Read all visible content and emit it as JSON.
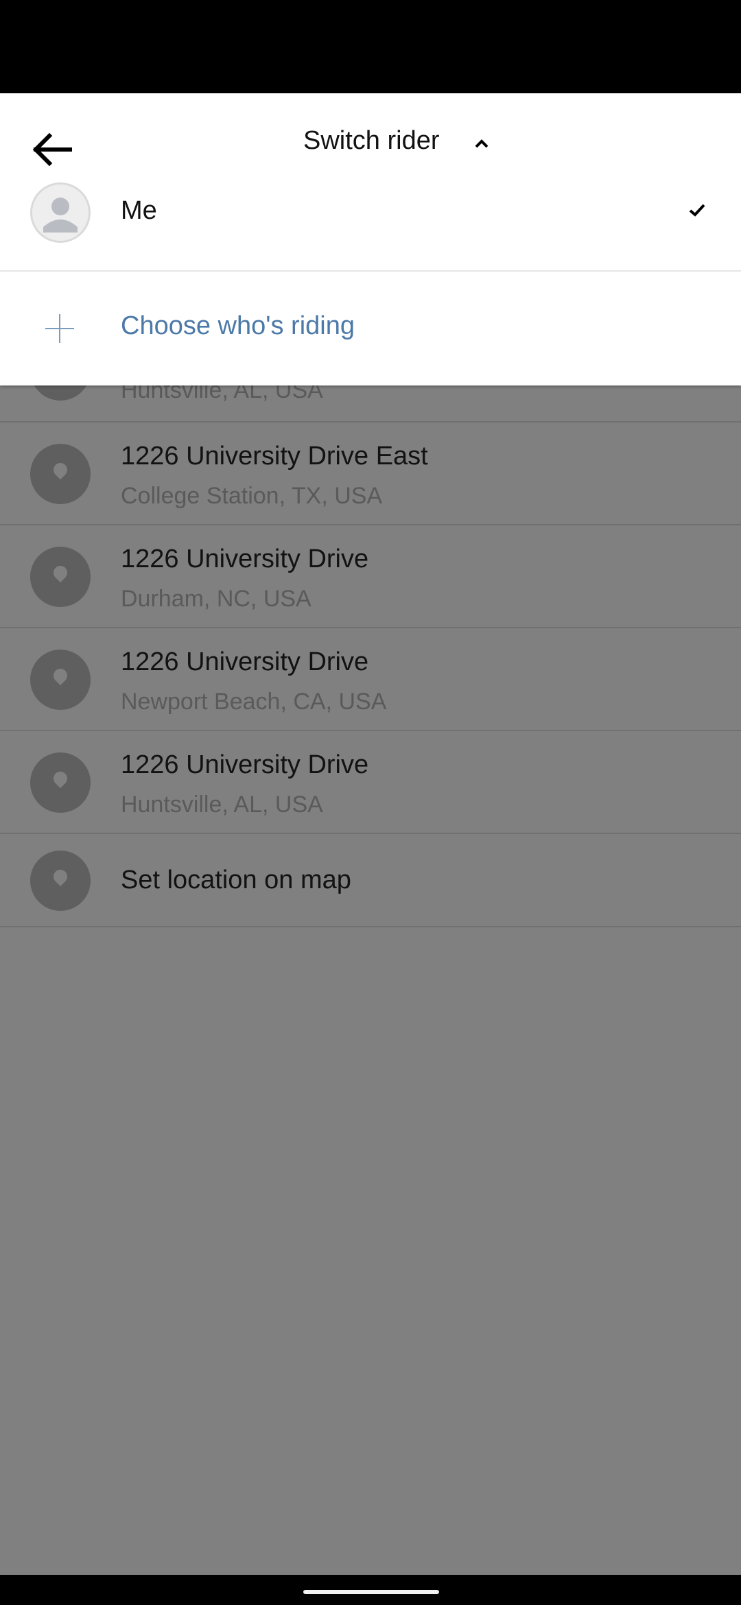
{
  "header": {
    "title": "Switch rider"
  },
  "rider": {
    "name": "Me"
  },
  "choose": {
    "label": "Choose who's riding"
  },
  "results": [
    {
      "title": "",
      "subtitle": "Huntsville, AL, USA"
    },
    {
      "title": "1226 University Drive East",
      "subtitle": "College Station, TX, USA"
    },
    {
      "title": "1226 University Drive",
      "subtitle": "Durham, NC, USA"
    },
    {
      "title": "1226 University Drive",
      "subtitle": "Newport Beach, CA, USA"
    },
    {
      "title": "1226 University Drive",
      "subtitle": "Huntsville, AL, USA"
    }
  ],
  "set_on_map": {
    "label": "Set location on map"
  },
  "colors": {
    "link_blue": "#4b79a8",
    "overlay_gray": "#808080"
  }
}
